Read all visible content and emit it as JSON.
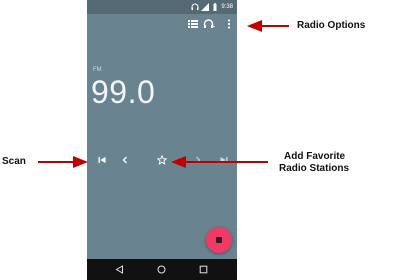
{
  "status_bar": {
    "time": "9:38"
  },
  "radio": {
    "band": "FM",
    "frequency": "99.0"
  },
  "icons": {
    "list": "list-icon",
    "audio_output": "headphones-icon",
    "overflow": "more-vert-icon",
    "previous": "skip-previous-icon",
    "seek_down": "chevron-left-icon",
    "favorite": "star-outline-icon",
    "seek_up": "chevron-right-icon",
    "next": "skip-next-icon",
    "stop": "stop-icon"
  },
  "annotations": {
    "radio_options": "Radio Options",
    "scan": "Scan",
    "favorite_line1": "Add Favorite",
    "favorite_line2": "Radio Stations"
  },
  "colors": {
    "screen": "#6a8390",
    "status_bar": "#556a75",
    "fab": "#ef3b63",
    "arrow": "#c00000"
  }
}
